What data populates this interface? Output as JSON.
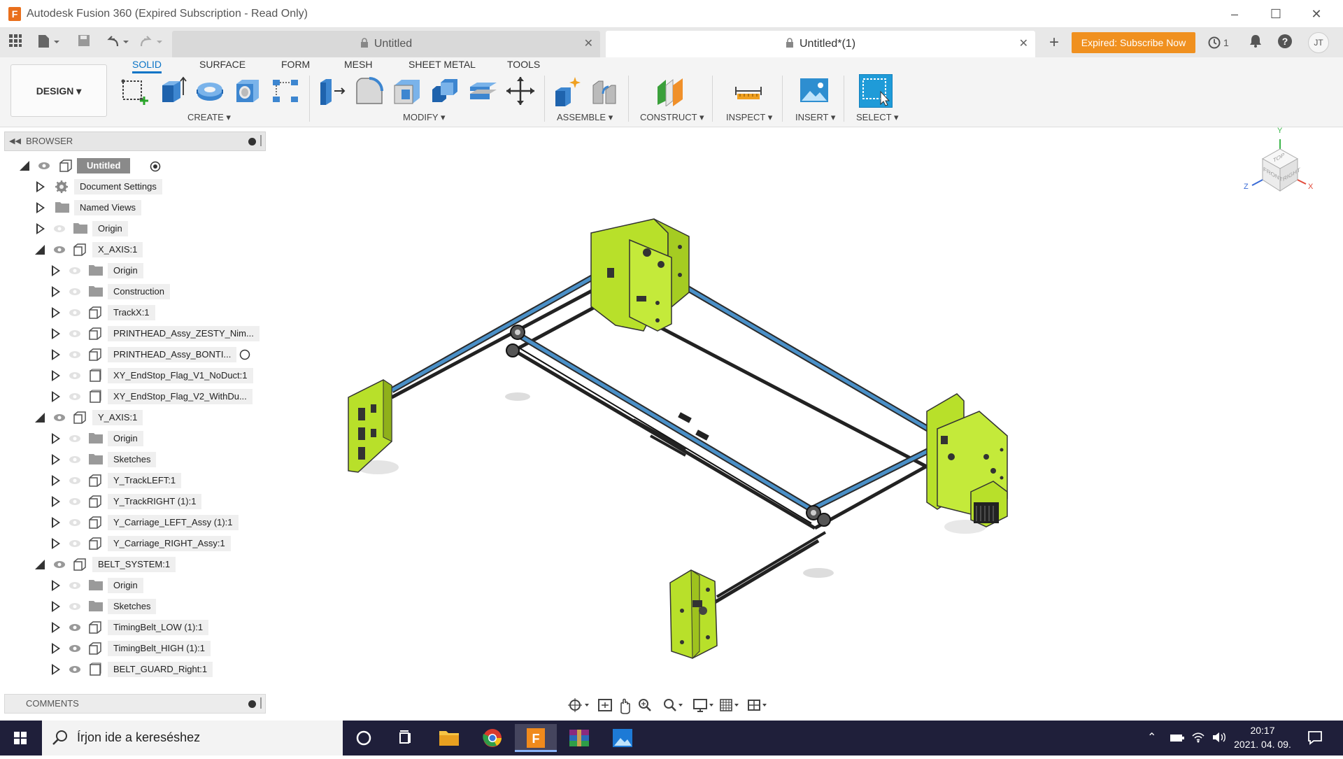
{
  "window": {
    "title": "Autodesk Fusion 360 (Expired Subscription - Read Only)",
    "app_icon_letter": "F"
  },
  "tabs": [
    {
      "label": "Untitled",
      "active": false
    },
    {
      "label": "Untitled*(1)",
      "active": true
    }
  ],
  "header": {
    "subscribe_label": "Expired: Subscribe Now",
    "jobs_count": "1",
    "user_initials": "JT"
  },
  "toolbar": {
    "workspace": "DESIGN",
    "tabs": [
      "SOLID",
      "SURFACE",
      "FORM",
      "MESH",
      "SHEET METAL",
      "TOOLS"
    ],
    "active_tab": "SOLID",
    "groups": [
      "CREATE",
      "MODIFY",
      "ASSEMBLE",
      "CONSTRUCT",
      "INSPECT",
      "INSERT",
      "SELECT"
    ]
  },
  "browser": {
    "title": "BROWSER",
    "root": "Untitled",
    "items": [
      {
        "label": "Document Settings",
        "icon": "gear-icon"
      },
      {
        "label": "Named Views",
        "icon": "folder-icon"
      },
      {
        "label": "Origin",
        "icon": "folder-icon"
      },
      {
        "label": "X_AXIS:1",
        "icon": "component-icon"
      },
      {
        "label": "Origin",
        "icon": "folder-icon"
      },
      {
        "label": "Construction",
        "icon": "folder-icon"
      },
      {
        "label": "TrackX:1",
        "icon": "component-icon"
      },
      {
        "label": "PRINTHEAD_Assy_ZESTY_Nim...",
        "icon": "component-icon"
      },
      {
        "label": "PRINTHEAD_Assy_BONTI...",
        "icon": "component-icon"
      },
      {
        "label": "XY_EndStop_Flag_V1_NoDuct:1",
        "icon": "body-icon"
      },
      {
        "label": "XY_EndStop_Flag_V2_WithDu...",
        "icon": "body-icon"
      },
      {
        "label": "Y_AXIS:1",
        "icon": "component-icon"
      },
      {
        "label": "Origin",
        "icon": "folder-icon"
      },
      {
        "label": "Sketches",
        "icon": "folder-icon"
      },
      {
        "label": "Y_TrackLEFT:1",
        "icon": "component-icon"
      },
      {
        "label": "Y_TrackRIGHT (1):1",
        "icon": "component-icon"
      },
      {
        "label": "Y_Carriage_LEFT_Assy (1):1",
        "icon": "component-icon"
      },
      {
        "label": "Y_Carriage_RIGHT_Assy:1",
        "icon": "component-icon"
      },
      {
        "label": "BELT_SYSTEM:1",
        "icon": "component-icon"
      },
      {
        "label": "Origin",
        "icon": "folder-icon"
      },
      {
        "label": "Sketches",
        "icon": "folder-icon"
      },
      {
        "label": "TimingBelt_LOW (1):1",
        "icon": "component-icon"
      },
      {
        "label": "TimingBelt_HIGH (1):1",
        "icon": "component-icon"
      },
      {
        "label": "BELT_GUARD_Right:1",
        "icon": "body-icon"
      }
    ]
  },
  "comments": {
    "title": "COMMENTS"
  },
  "viewcube": {
    "top": "TOP",
    "front": "FRONT",
    "right": "RIGHT",
    "axis_x": "X",
    "axis_y": "Y",
    "axis_z": "Z"
  },
  "taskbar": {
    "search_placeholder": "Írjon ide a kereséshez",
    "time": "20:17",
    "date": "2021. 04. 09."
  },
  "colors": {
    "accent": "#0a74c6",
    "subscribe": "#f0901f",
    "part": "#b8e02a",
    "rail": "#4a90c8"
  }
}
